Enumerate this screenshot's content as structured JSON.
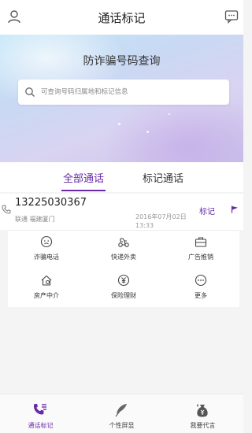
{
  "header": {
    "title": "通话标记",
    "left_icon": "user-icon",
    "right_icon": "message-icon"
  },
  "hero": {
    "headline": "防诈骗号码查询",
    "search_placeholder": "可查询号码归属地和标记信息"
  },
  "tabs": [
    {
      "label": "全部通话",
      "active": true
    },
    {
      "label": "标记通话",
      "active": false
    }
  ],
  "call": {
    "number": "13225030367",
    "location": "联通 福建厦门",
    "date": "2016年07月02日",
    "time": "13:33",
    "mark_label": "标记"
  },
  "categories": [
    {
      "label": "诈骗电话",
      "icon": "fraud-icon"
    },
    {
      "label": "快递外卖",
      "icon": "delivery-icon"
    },
    {
      "label": "广告推销",
      "icon": "briefcase-icon"
    },
    {
      "label": "房产中介",
      "icon": "house-icon"
    },
    {
      "label": "保险理财",
      "icon": "finance-icon"
    },
    {
      "label": "更多",
      "icon": "more-icon"
    }
  ],
  "bottom_nav": [
    {
      "label": "通话标记",
      "icon": "call-list-icon",
      "active": true
    },
    {
      "label": "个性屏显",
      "icon": "feather-icon",
      "active": false
    },
    {
      "label": "我要代言",
      "icon": "money-bag-icon",
      "active": false
    }
  ],
  "colors": {
    "accent": "#6a2aa8",
    "background": "#f4f4f4"
  }
}
